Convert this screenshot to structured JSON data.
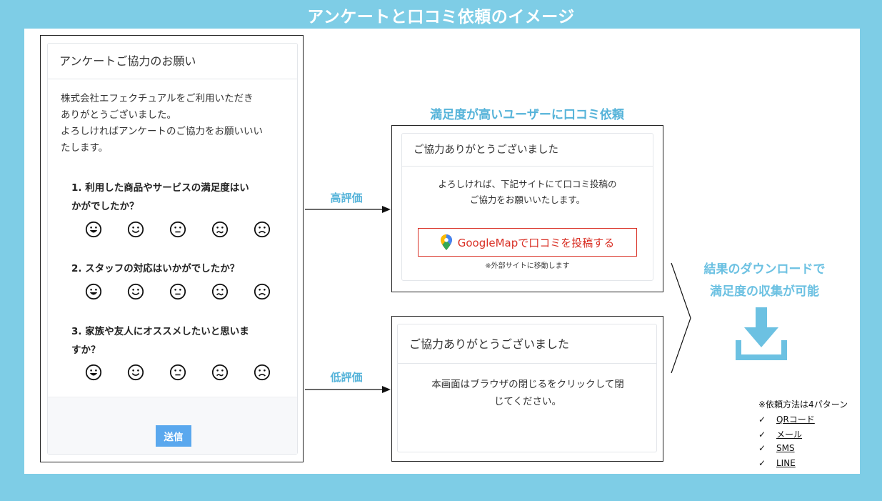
{
  "title": "アンケートと口コミ依頼のイメージ",
  "survey": {
    "header": "アンケートご協力のお願い",
    "intro": [
      "株式会社エフェクチュアルをご利用いただき",
      "ありがとうございました。",
      "よろしければアンケートのご協力をお願いいい",
      "たします。"
    ],
    "questions": [
      {
        "lines": [
          "1. 利用した商品やサービスの満足度はい",
          "かがでしたか？"
        ]
      },
      {
        "lines": [
          "2. スタッフの対応はいかがでしたか？"
        ]
      },
      {
        "lines": [
          "3. 家族や友人にオススメしたいと思いま",
          "すか？"
        ]
      }
    ],
    "face_icons": [
      "very-happy-icon",
      "smile-icon",
      "neutral-icon",
      "unhappy-icon",
      "sad-icon"
    ],
    "submit_label": "送信",
    "submit_color": "#5aa8ee"
  },
  "arrows": {
    "high_label": "高評価",
    "low_label": "低評価"
  },
  "high": {
    "heading": "満足度が高いユーザーに口コミ依頼",
    "header": "ご協力ありがとうございました",
    "message": [
      "よろしければ、下記サイトにて口コミ投稿の",
      "ご協力をお願いいたします。"
    ],
    "button_label": "GoogleMapで口コミを投稿する",
    "button_color": "#d93025",
    "note": "※外部サイトに移動します"
  },
  "low": {
    "header": "ご協力ありがとうございました",
    "message": [
      "本画面はブラウザの閉じるをクリックして閉",
      "じてください。"
    ]
  },
  "result": {
    "lines": [
      "結果のダウンロードで",
      "満足度の収集が可能"
    ],
    "accent_color": "#6cc1e2"
  },
  "methods": {
    "title": "※依頼方法は4パターン",
    "items": [
      "QRコード",
      "メール",
      "SMS",
      "LINE"
    ]
  }
}
